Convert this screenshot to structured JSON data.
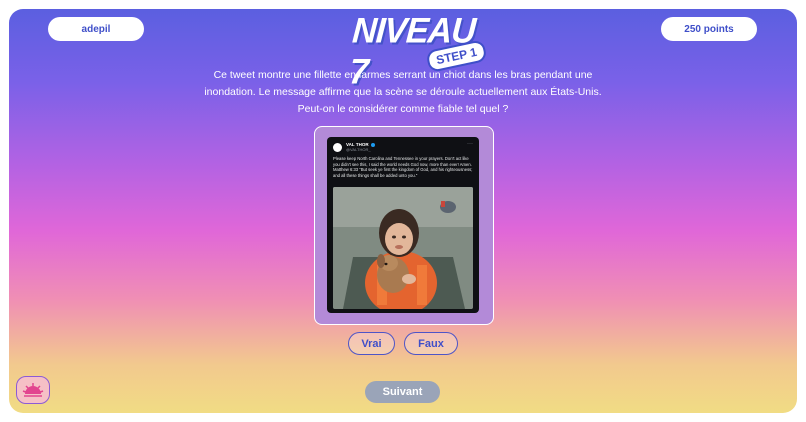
{
  "header": {
    "username": "adepil",
    "points": "250 points",
    "level_title": "NIVEAU 7",
    "step_badge": "STEP 1"
  },
  "question": {
    "text": "Ce tweet montre une fillette en larmes serrant un chiot dans les bras pendant une inondation. Le message affirme que la scène se déroule actuellement aux États-Unis. Peut-on le considérer comme fiable tel quel ?"
  },
  "tweet": {
    "author_name": "VAL THOR",
    "author_handle": "@VALTHOR_",
    "text": "Please keep North Carolina and Tennessee in your prayers. Don't act like you didn't see this, I said the world needs God now, more than ever! Amen. Matthew 6:33 “But seek ye first the kingdom of God, and his righteousness; and all these things shall be added unto you.”"
  },
  "answers": {
    "true_label": "Vrai",
    "false_label": "Faux"
  },
  "footer": {
    "next_label": "Suivant"
  },
  "colors": {
    "accent": "#3f4fc9",
    "gradient_top": "#5b5fe0",
    "gradient_mid": "#e067d8",
    "gradient_bottom": "#f1dc84",
    "next_button": "#9aa4b8"
  },
  "icons": {
    "logo": "sun-logo-icon",
    "verified": "verified-badge-icon",
    "more": "more-dots-icon"
  }
}
